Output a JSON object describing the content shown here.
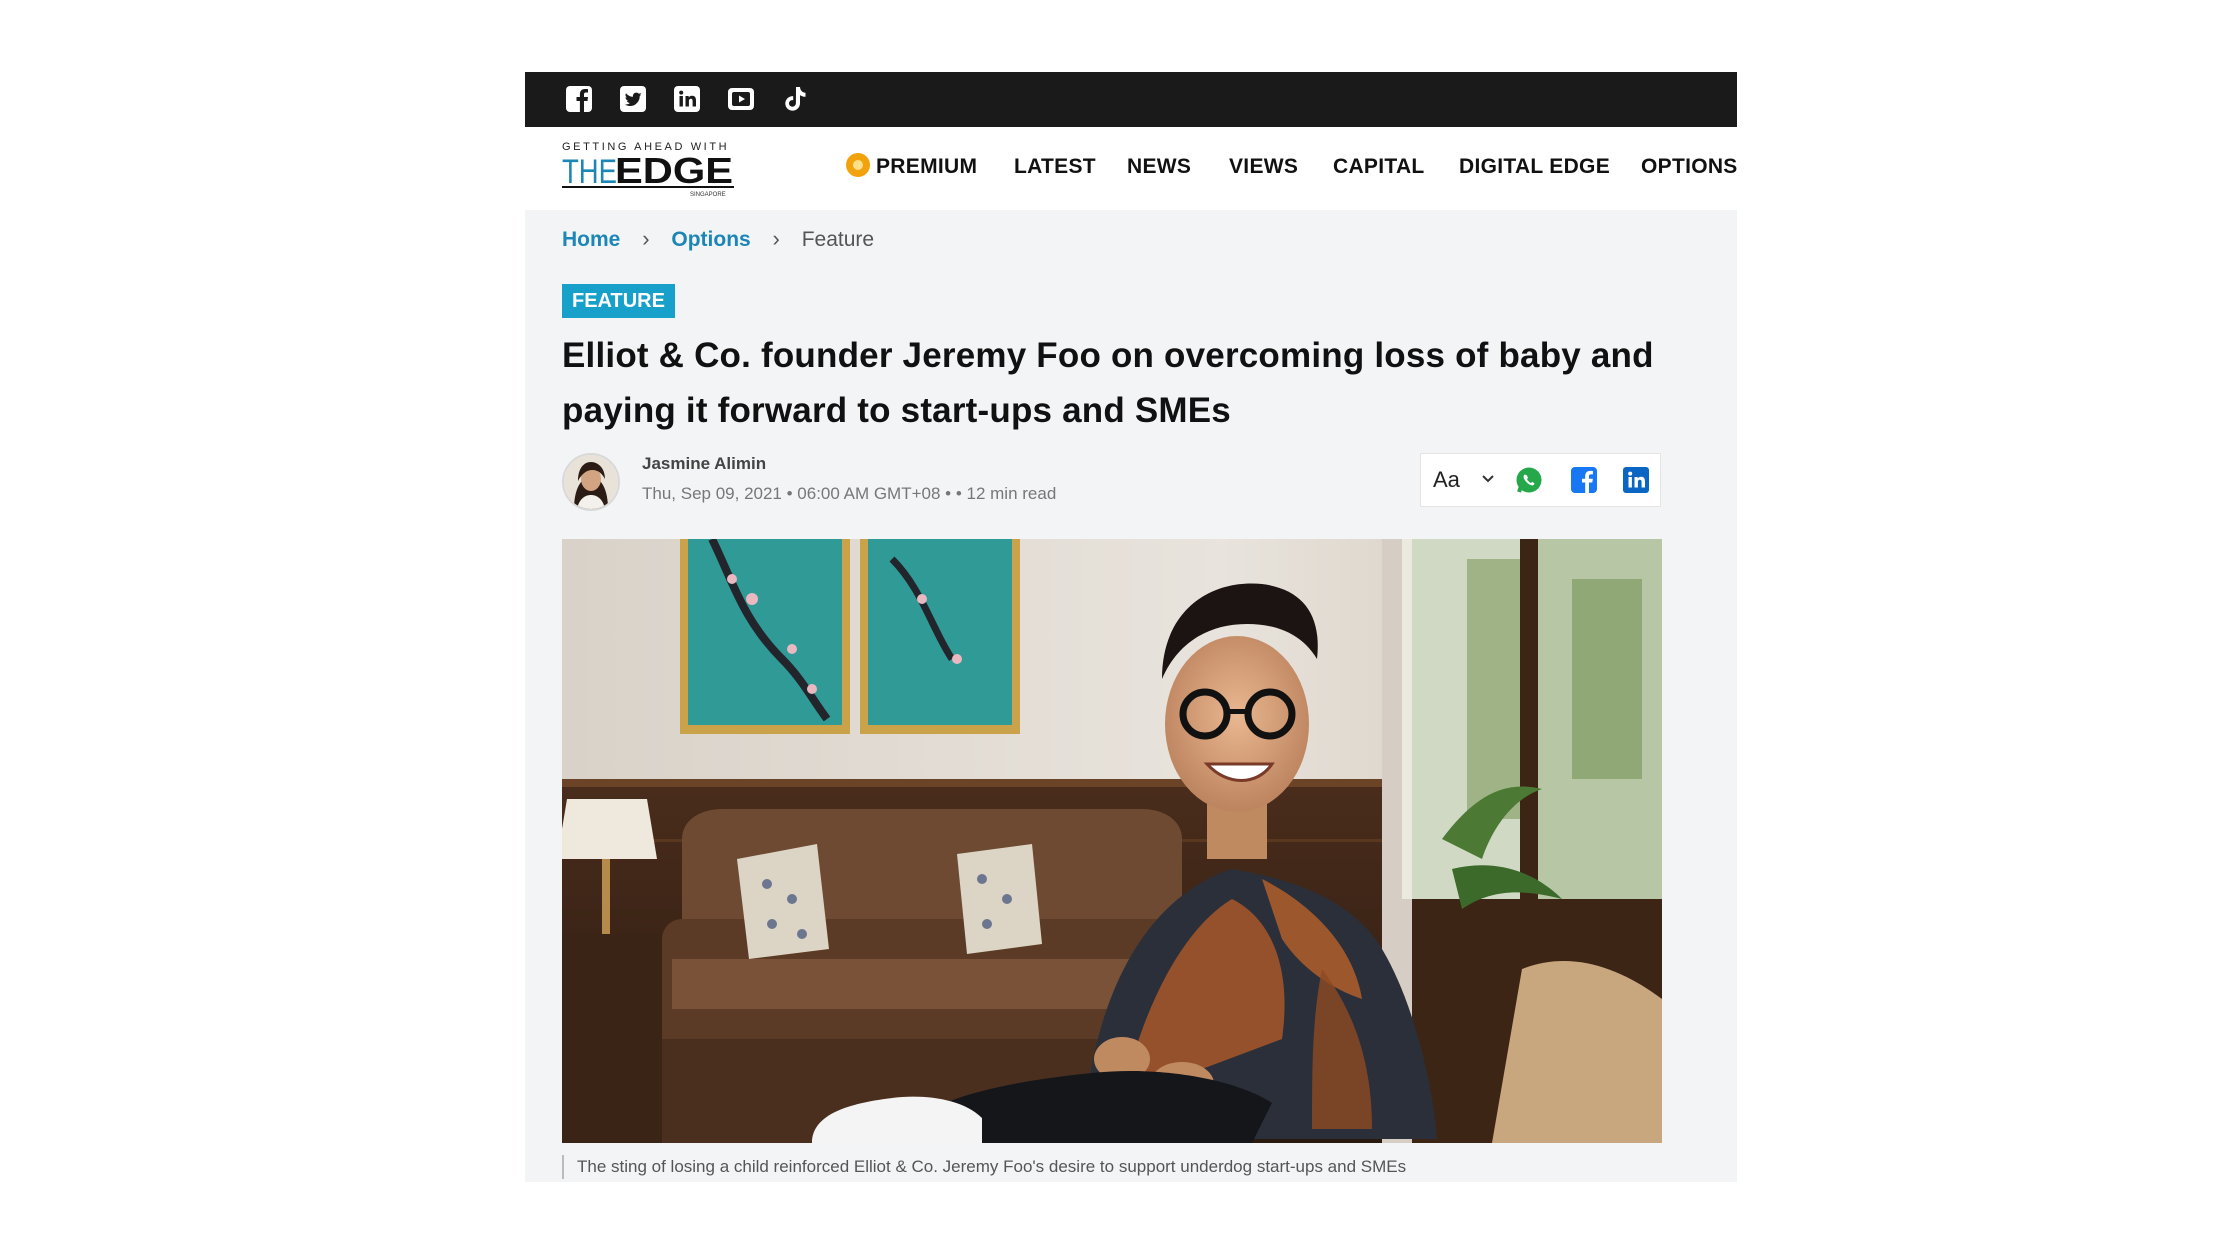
{
  "social": {
    "icons": [
      "facebook-icon",
      "twitter-icon",
      "linkedin-icon",
      "youtube-icon",
      "tiktok-icon"
    ]
  },
  "logo": {
    "tagline": "GETTING AHEAD WITH",
    "the": "THE",
    "edge": "EDGE",
    "region": "SINGAPORE"
  },
  "nav": {
    "premium": "PREMIUM",
    "latest": "LATEST",
    "news": "NEWS",
    "views": "VIEWS",
    "capital": "CAPITAL",
    "digital_edge": "DIGITAL EDGE",
    "options": "OPTIONS"
  },
  "breadcrumb": {
    "home": "Home",
    "options": "Options",
    "current": "Feature"
  },
  "article": {
    "badge": "FEATURE",
    "headline": "Elliot & Co. founder Jeremy Foo on overcoming loss of baby and paying it forward to start-ups and SMEs",
    "author": "Jasmine Alimin",
    "meta": "Thu, Sep 09, 2021 • 06:00 AM GMT+08 •  • 12 min read",
    "font_button": "Aa",
    "caption": "The sting of losing a child reinforced Elliot & Co. Jeremy Foo's desire to support underdog start-ups and SMEs"
  },
  "colors": {
    "accent": "#17a0c9",
    "link": "#1c86b7",
    "premium_coin": "#f2a20c",
    "whatsapp": "#25a84a",
    "facebook": "#1877f2",
    "linkedin": "#0a66c2",
    "topbar": "#1a1a1a"
  }
}
